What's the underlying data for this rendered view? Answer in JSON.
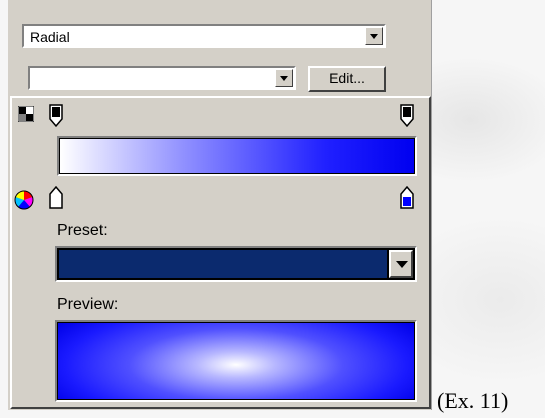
{
  "gradient_type": {
    "value": "Radial"
  },
  "second_combo": {
    "value": ""
  },
  "edit_button": {
    "label": "Edit..."
  },
  "popup": {
    "preset_label": "Preset:",
    "preview_label": "Preview:",
    "gradient_start_color": "#ffffff",
    "gradient_end_color": "#0000f0",
    "preset_color": "#0b2a6e"
  },
  "caption": "(Ex. 11)"
}
